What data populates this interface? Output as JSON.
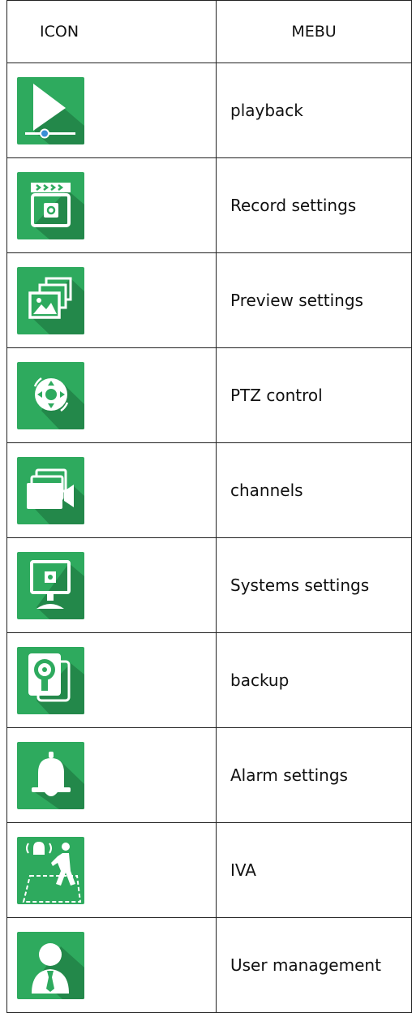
{
  "header": {
    "icon_col": "ICON",
    "menu_col": "MEBU"
  },
  "rows": [
    {
      "icon": "playback-icon",
      "label": "playback"
    },
    {
      "icon": "record-settings-icon",
      "label": "Record settings"
    },
    {
      "icon": "preview-settings-icon",
      "label": "Preview settings"
    },
    {
      "icon": "ptz-control-icon",
      "label": "PTZ control"
    },
    {
      "icon": "channels-icon",
      "label": "channels"
    },
    {
      "icon": "system-settings-icon",
      "label": "Systems settings"
    },
    {
      "icon": "backup-icon",
      "label": "backup"
    },
    {
      "icon": "alarm-bell-icon",
      "label": "Alarm settings"
    },
    {
      "icon": "iva-icon",
      "label": "IVA"
    },
    {
      "icon": "user-management-icon",
      "label": "User management"
    }
  ],
  "colors": {
    "tile": "#2eaa5e",
    "tile_shadow": "#23884a",
    "glyph": "#ffffff",
    "accent_blue": "#3a8fd6"
  }
}
